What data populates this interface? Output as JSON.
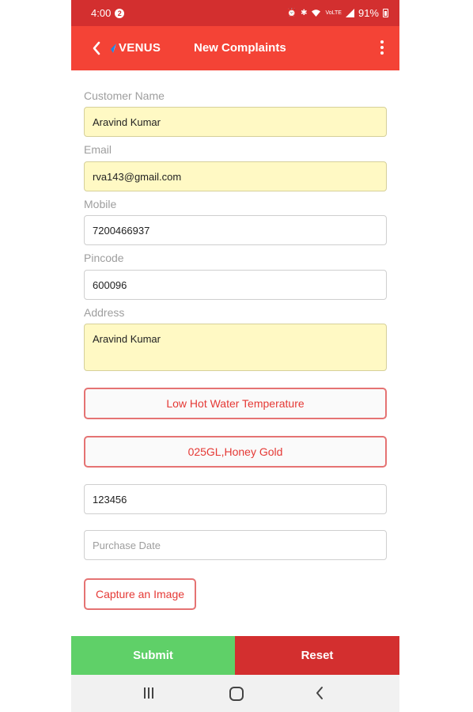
{
  "status_bar": {
    "time": "4:00",
    "badge": "2",
    "battery": "91%",
    "network": "VoLTE"
  },
  "app_bar": {
    "logo_text": "VENUS",
    "title": "New Complaints"
  },
  "form": {
    "customer_name": {
      "label": "Customer Name",
      "value": "Aravind Kumar"
    },
    "email": {
      "label": "Email",
      "value": "rva143@gmail.com"
    },
    "mobile": {
      "label": "Mobile",
      "value": "7200466937"
    },
    "pincode": {
      "label": "Pincode",
      "value": "600096"
    },
    "address": {
      "label": "Address",
      "value": "Aravind Kumar"
    },
    "complaint_type": {
      "value": "Low Hot Water Temperature"
    },
    "product_model": {
      "value": "025GL,Honey Gold"
    },
    "serial_number": {
      "value": "123456"
    },
    "purchase_date": {
      "value": "",
      "placeholder": "Purchase Date"
    },
    "capture_image_label": "Capture an Image"
  },
  "actions": {
    "submit_label": "Submit",
    "reset_label": "Reset"
  },
  "colors": {
    "status_bar": "#d32f2f",
    "app_bar": "#f44336",
    "submit": "#5fd068",
    "reset": "#d32f2f",
    "prefilled_field": "#fff9c4"
  }
}
